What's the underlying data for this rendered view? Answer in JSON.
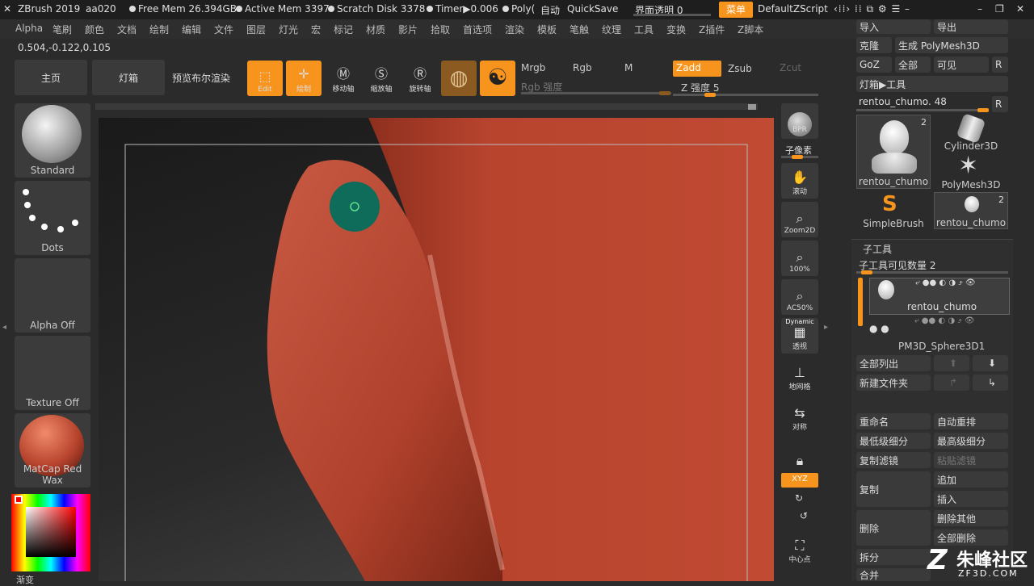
{
  "titlebar": {
    "app": "ZBrush 2019",
    "user": "aa020",
    "free_mem": "Free Mem 26.394GB",
    "active_mem": "Active Mem 3397",
    "scratch": "Scratch Disk 3378",
    "timer": "Timer▶0.006",
    "poly": "Poly(",
    "auto": "自动",
    "quicksave": "QuickSave",
    "transparency": "界面透明 0",
    "menu": "菜单",
    "zscript": "DefaultZScript"
  },
  "menubar": [
    "Alpha",
    "笔刷",
    "颜色",
    "文档",
    "绘制",
    "编辑",
    "文件",
    "图层",
    "灯光",
    "宏",
    "标记",
    "材质",
    "影片",
    "拾取",
    "首选项",
    "渲染",
    "模板",
    "笔触",
    "纹理",
    "工具",
    "变换",
    "Z插件",
    "Z脚本"
  ],
  "coords": "0.504,-0.122,0.105",
  "toolbar": {
    "home": "主页",
    "lightbox": "灯箱",
    "bpr_preview": "预览布尔渲染",
    "edit": "Edit",
    "draw": "绘制",
    "move": "移动轴",
    "scale": "缩放轴",
    "rotate": "旋转轴",
    "mrgb": "Mrgb",
    "rgb": "Rgb",
    "m": "M",
    "rgb_intensity": "Rgb 强度",
    "zadd": "Zadd",
    "zsub": "Zsub",
    "zcut": "Zcut",
    "z_intensity": "Z 强度 5"
  },
  "left": {
    "brush": "Standard",
    "stroke": "Dots",
    "alpha": "Alpha Off",
    "texture": "Texture Off",
    "material": "MatCap Red Wax",
    "gradient": "渐变"
  },
  "rightshelf": {
    "bpr": "BPR",
    "subpixel": "子像素",
    "scroll": "滚动",
    "zoom2d": "Zoom2D",
    "p100": "100%",
    "ac50": "AC50%",
    "dynamic": "Dynamic",
    "perspective": "透视",
    "floor": "地网格",
    "symmetry": "对称",
    "xyz": "XYZ",
    "center": "中心点"
  },
  "tool": {
    "import": "导入",
    "export": "导出",
    "clone": "克隆",
    "make_polymesh": "生成 PolyMesh3D",
    "goz": "GoZ",
    "all": "全部",
    "visible": "可见",
    "r": "R",
    "lightbox_tool": "灯箱▶工具",
    "current_tool": "rentou_chumo. 48",
    "thumbs": [
      {
        "name": "rentou_chumo",
        "count": "2"
      },
      {
        "name": "Cylinder3D"
      },
      {
        "name": "PolyMesh3D"
      },
      {
        "name": "SimpleBrush"
      },
      {
        "name": "rentou_chumo",
        "count": "2"
      }
    ]
  },
  "subtool": {
    "header": "子工具",
    "visible_count": "子工具可见数量 2",
    "items": [
      "rentou_chumo",
      "PM3D_Sphere3D1"
    ],
    "list_all": "全部列出",
    "new_folder": "新建文件夹",
    "rename": "重命名",
    "auto_reorder": "自动重排",
    "lowest_sub": "最低级细分",
    "highest_sub": "最高级细分",
    "copy_filter": "复制滤镜",
    "paste_filter": "粘贴滤镜",
    "duplicate": "复制",
    "append": "追加",
    "insert": "插入",
    "delete": "删除",
    "delete_other": "删除其他",
    "delete_all": "全部删除",
    "split": "拆分",
    "merge": "合并"
  },
  "watermark": {
    "cn": "朱峰社区",
    "url": "ZF3D.COM"
  },
  "colors": {
    "accent": "#f7941d",
    "model": "#b8442e"
  }
}
